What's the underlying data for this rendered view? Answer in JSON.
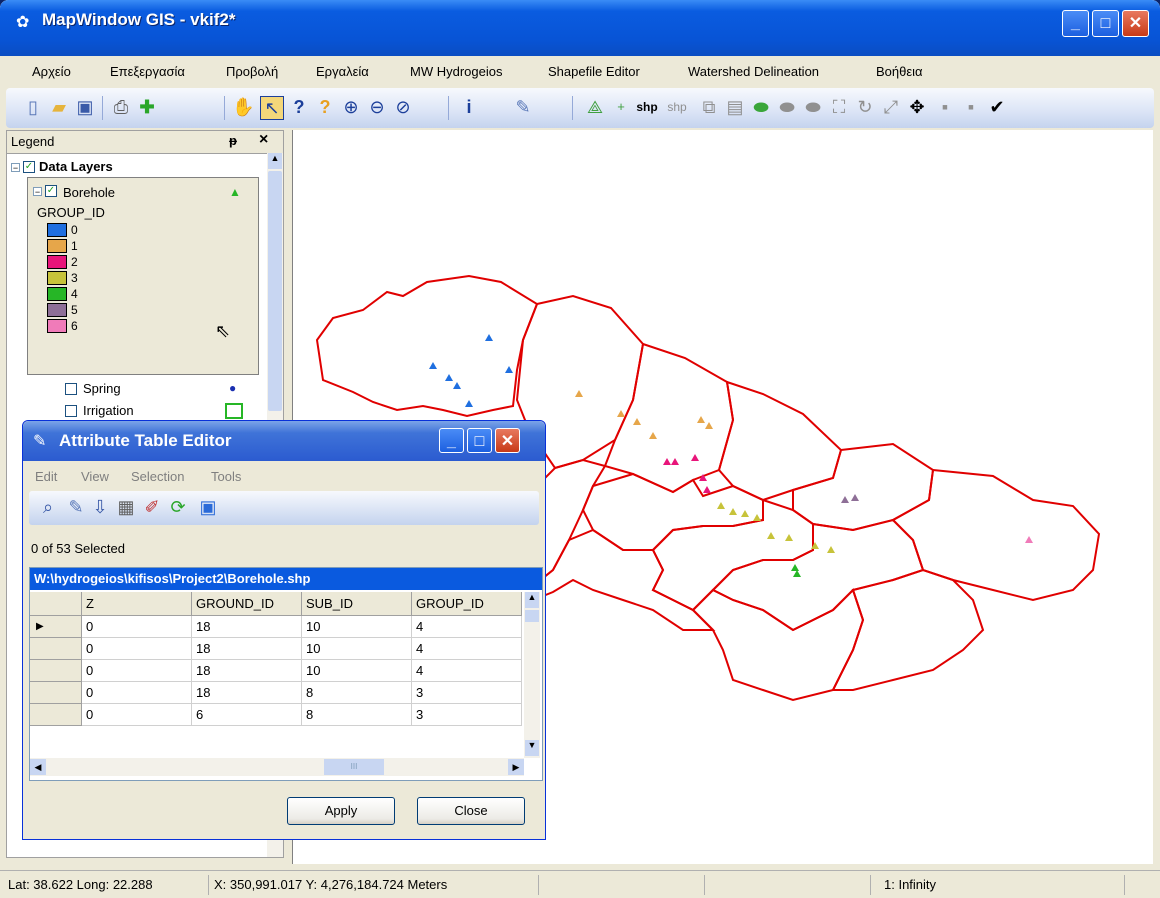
{
  "app": {
    "title": "MapWindow GIS  - vkif2*"
  },
  "menu": [
    "Αρχείο",
    "Επεξεργασία",
    "Προβολή",
    "Εργαλεία",
    "MW Hydrogeios",
    "Shapefile Editor",
    "Watershed Delineation",
    "Βοήθεια"
  ],
  "toolbar": {
    "icons": [
      "new-icon",
      "open-icon",
      "save-icon",
      "print-icon",
      "add-layer-icon",
      "pan-icon",
      "select-icon",
      "identify-icon",
      "query-icon",
      "zoom-in-icon",
      "zoom-out-icon",
      "zoom-extent-icon",
      "info-icon",
      "edit-icon"
    ],
    "shp_label1": "shp",
    "shp_label2": "shp"
  },
  "legend": {
    "title": "Legend",
    "pin": "ᵽ",
    "close": "×",
    "group": "Data Layers",
    "layer1": "Borehole",
    "field": "GROUP_ID",
    "classes": [
      {
        "label": "0",
        "color": "#1f6fe0"
      },
      {
        "label": "1",
        "color": "#e6a64a"
      },
      {
        "label": "2",
        "color": "#e8157a"
      },
      {
        "label": "3",
        "color": "#c7c33a"
      },
      {
        "label": "4",
        "color": "#26b626"
      },
      {
        "label": "5",
        "color": "#8e6f97"
      },
      {
        "label": "6",
        "color": "#f07bb9"
      }
    ],
    "layer2": "Spring",
    "layer3": "Irrigation"
  },
  "attribute_editor": {
    "title": "Attribute Table Editor",
    "menus": [
      "Edit",
      "View",
      "Selection",
      "Tools"
    ],
    "selected_text": "0 of 53 Selected",
    "file_path": "W:\\hydrogeios\\kifisos\\Project2\\Borehole.shp",
    "columns": [
      "Z",
      "GROUND_ID",
      "SUB_ID",
      "GROUP_ID"
    ],
    "rows": [
      [
        "0",
        "18",
        "10",
        "4"
      ],
      [
        "0",
        "18",
        "10",
        "4"
      ],
      [
        "0",
        "18",
        "10",
        "4"
      ],
      [
        "0",
        "18",
        "8",
        "3"
      ],
      [
        "0",
        "6",
        "8",
        "3"
      ]
    ],
    "scroll_mark": "III",
    "apply_label": "Apply",
    "close_label": "Close"
  },
  "status": {
    "latlong": "Lat: 38.622 Long: 22.288",
    "xy": "X: 350,991.017 Y: 4,276,184.724 Meters",
    "scale": "1: Infinity"
  },
  "map": {
    "boundary_color": "#e00000"
  }
}
